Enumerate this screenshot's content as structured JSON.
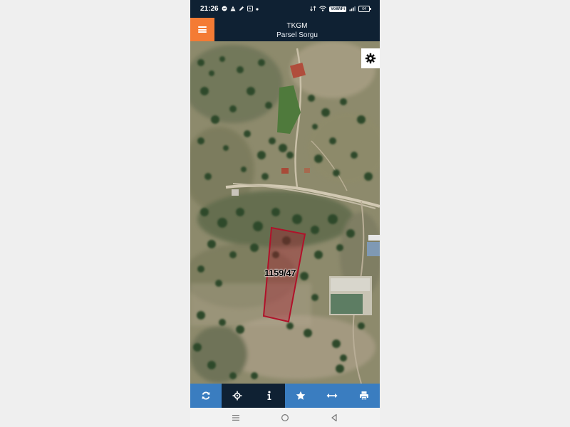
{
  "status_bar": {
    "time": "21:26",
    "left_icons": [
      "messenger-icon",
      "alert-icon",
      "pen-icon",
      "app-icon",
      "dot-icon"
    ],
    "right_icons": [
      "data-icon",
      "wifi-icon",
      "vowifi-icon",
      "signal-icon",
      "battery-icon"
    ],
    "vowifi_label": "VoWiFi",
    "battery_level": "64"
  },
  "app_bar": {
    "title": "TKGM",
    "subtitle": "Parsel Sorgu",
    "menu_icon": "hamburger-icon",
    "accent_color": "#f47b34",
    "bar_color": "#0f2133"
  },
  "map": {
    "parcel_label": "1159/47",
    "parcel_color": "#b0122a",
    "settings_icon": "gear-icon"
  },
  "toolbar": {
    "color": "#3a7dc0",
    "active_color": "#0f2133",
    "items": [
      {
        "name": "refresh",
        "icon": "refresh-icon",
        "active": false
      },
      {
        "name": "locate",
        "icon": "crosshair-icon",
        "active": true
      },
      {
        "name": "info",
        "icon": "info-icon",
        "active": true
      },
      {
        "name": "favorite",
        "icon": "star-icon",
        "active": false
      },
      {
        "name": "measure",
        "icon": "arrows-horizontal-icon",
        "active": false
      },
      {
        "name": "print",
        "icon": "printer-icon",
        "active": false
      }
    ]
  },
  "nav_bar": {
    "items": [
      "menu-icon",
      "home-icon",
      "back-icon"
    ]
  }
}
